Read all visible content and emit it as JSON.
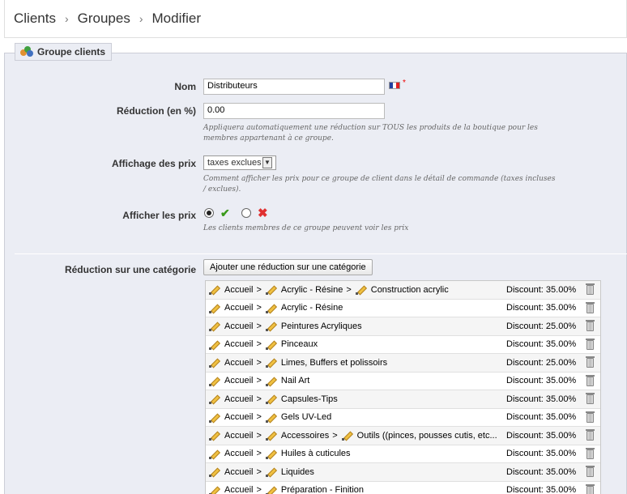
{
  "breadcrumb": {
    "items": [
      "Clients",
      "Groupes",
      "Modifier"
    ],
    "sep": "›"
  },
  "panel": {
    "legend": "Groupe clients"
  },
  "form": {
    "name_label": "Nom",
    "name_value": "Distributeurs",
    "required_mark": "*",
    "reduction_label": "Réduction (en %)",
    "reduction_value": "0.00",
    "reduction_hint": "Appliquera automatiquement une réduction sur TOUS les produits de la boutique pour les membres appartenant à ce groupe.",
    "price_display_label": "Affichage des prix",
    "price_display_value": "taxes exclues",
    "price_display_hint": "Comment afficher les prix pour ce groupe de client dans le détail de commande (taxes incluses / exclues).",
    "show_prices_label": "Afficher les prix",
    "show_prices_value": "yes",
    "show_prices_hint": "Les clients membres de ce groupe peuvent voir les prix",
    "category_reduction_label": "Réduction sur une catégorie",
    "add_category_button": "Ajouter une réduction sur une catégorie"
  },
  "categories": [
    {
      "path": [
        "Accueil",
        "Acrylic - Résine",
        "Construction acrylic"
      ],
      "discount": "Discount: 35.00%"
    },
    {
      "path": [
        "Accueil",
        "Acrylic - Résine"
      ],
      "discount": "Discount: 35.00%"
    },
    {
      "path": [
        "Accueil",
        "Peintures Acryliques"
      ],
      "discount": "Discount: 25.00%"
    },
    {
      "path": [
        "Accueil",
        "Pinceaux"
      ],
      "discount": "Discount: 35.00%"
    },
    {
      "path": [
        "Accueil",
        "Limes, Buffers et polissoirs"
      ],
      "discount": "Discount: 25.00%"
    },
    {
      "path": [
        "Accueil",
        "Nail Art"
      ],
      "discount": "Discount: 35.00%"
    },
    {
      "path": [
        "Accueil",
        "Capsules-Tips"
      ],
      "discount": "Discount: 35.00%"
    },
    {
      "path": [
        "Accueil",
        "Gels UV-Led"
      ],
      "discount": "Discount: 35.00%"
    },
    {
      "path": [
        "Accueil",
        "Accessoires",
        "Outils ((pinces, pousses cutis, etc..."
      ],
      "discount": "Discount: 35.00%"
    },
    {
      "path": [
        "Accueil",
        "Huiles à cuticules"
      ],
      "discount": "Discount: 35.00%"
    },
    {
      "path": [
        "Accueil",
        "Liquides"
      ],
      "discount": "Discount: 35.00%"
    },
    {
      "path": [
        "Accueil",
        "Préparation - Finition"
      ],
      "discount": "Discount: 35.00%"
    }
  ],
  "colors": {
    "panel_bg": "#ebedf4",
    "check": "#3a9a1a",
    "cross": "#e03030"
  }
}
